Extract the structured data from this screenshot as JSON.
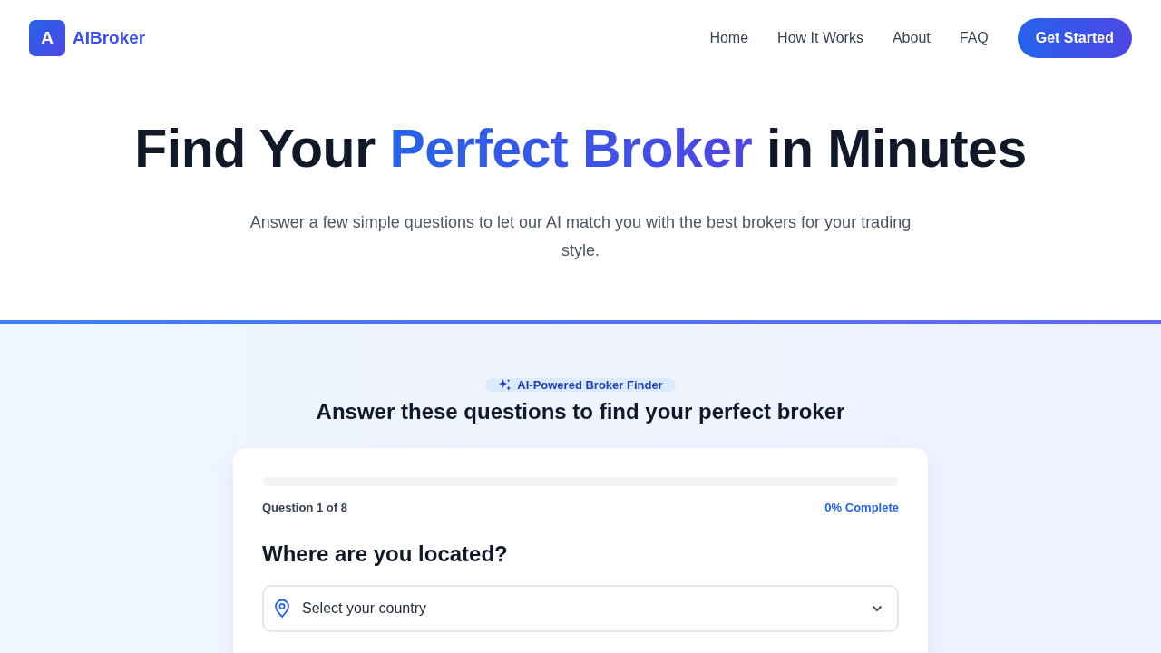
{
  "brand": {
    "logo_letter": "A",
    "name": "AIBroker"
  },
  "nav": {
    "links": [
      "Home",
      "How It Works",
      "About",
      "FAQ"
    ],
    "cta": "Get Started"
  },
  "hero": {
    "title": [
      {
        "text": "Find Your ",
        "highlight": false
      },
      {
        "text": "Perfect Broker",
        "highlight": true
      },
      {
        "text": " in Minutes",
        "highlight": false
      }
    ],
    "subtitle": "Answer a few simple questions to let our AI match you with the best brokers for your trading style."
  },
  "finder": {
    "badge": "AI-Powered Broker Finder",
    "heading": "Answer these questions to find your perfect broker",
    "progress": {
      "level": 0,
      "step": "Question 1 of 8",
      "percent": "0% Complete"
    },
    "question": "Where are you located?",
    "country_select": {
      "placeholder": "Select your country"
    }
  }
}
